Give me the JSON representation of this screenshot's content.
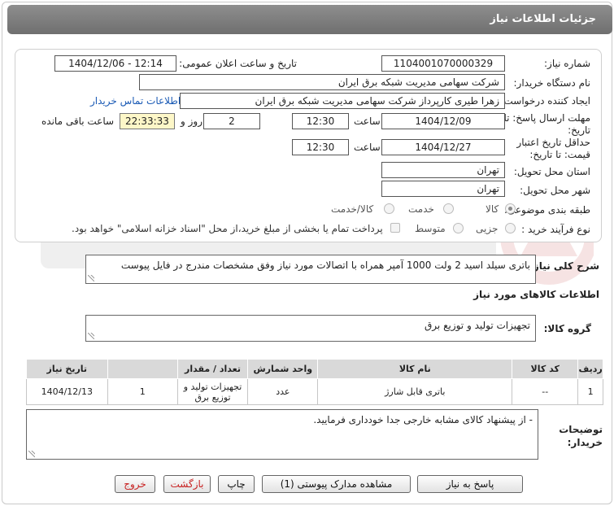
{
  "header": {
    "title": "جزئیات اطلاعات نیاز"
  },
  "form": {
    "need_number_label": "شماره نیاز:",
    "need_number": "1104001070000329",
    "announce_label": "تاریخ و ساعت اعلان عمومی:",
    "announce_value": "1404/12/06 - 12:14",
    "buyer_org_label": "نام دستگاه خریدار:",
    "buyer_org": "شرکت سهامی مدیریت شبکه برق ایران",
    "creator_label": "ایجاد کننده درخواست:",
    "creator": "زهرا طیری کارپرداز شرکت سهامی مدیریت شبکه برق ایران",
    "contact_link": "اطلاعات تماس خریدار",
    "deadline_label_1": "مهلت ارسال پاسخ: تا",
    "deadline_label_2": "تاریخ:",
    "deadline_date": "1404/12/09",
    "time_label": "ساعت",
    "deadline_time": "12:30",
    "days_value": "2",
    "days_label": "روز و",
    "remaining_value": "22:33:33",
    "remaining_label": "ساعت باقی مانده",
    "validity_label_1": "حداقل تاریخ اعتبار",
    "validity_label_2": "قیمت: تا تاریخ:",
    "validity_date": "1404/12/27",
    "validity_time": "12:30",
    "province_label": "استان محل تحویل:",
    "province": "تهران",
    "city_label": "شهر محل تحویل:",
    "city": "تهران",
    "category_label": "طبقه بندی موضوعی:",
    "category_options": [
      "کالا",
      "خدمت",
      "کالا/خدمت"
    ],
    "process_label": "نوع فرآیند خرید :",
    "process_options": [
      "جزیی",
      "متوسط"
    ],
    "payment_note": "پرداخت تمام یا بخشی از مبلغ خرید،از محل \"اسناد خزانه اسلامی\" خواهد بود."
  },
  "summary": {
    "label": "شرح کلی نیاز:",
    "text": "باتری سیلد اسید 2 ولت 1000 آمپر همراه با اتصالات مورد نیاز وفق مشخصات مندرج در فایل پیوست"
  },
  "goods": {
    "section_title": "اطلاعات کالاهای مورد نیاز",
    "group_label": "گروه کالا:",
    "group_value": "تجهیزات تولید و توزیع برق",
    "columns": [
      "ردیف",
      "کد کالا",
      "نام کالا",
      "واحد شمارش",
      "تعداد / مقدار",
      "تاریخ نیاز"
    ],
    "rows": [
      {
        "row": "1",
        "code": "--",
        "name": "باتری قابل شارژ",
        "unit": "عدد",
        "qty": "1",
        "date": "1404/12/13",
        "extra": "تجهیزات تولید و توزیع برق"
      }
    ]
  },
  "buyer_notes": {
    "label_1": "توضیحات",
    "label_2": "خریدار:",
    "text": "- از پیشنهاد کالای مشابه خارجی جدا خودداری فرمایید."
  },
  "buttons": {
    "reply": "پاسخ به نیاز",
    "attachments": "مشاهده مدارک پیوستی (1)",
    "print": "چاپ",
    "back": "بازگشت",
    "exit": "خروج"
  },
  "colors": {
    "title_bar": "#7d7d7d",
    "remaining_bg": "#fdf7c8",
    "link": "#1a5ab5",
    "exit_text": "#c82020"
  }
}
